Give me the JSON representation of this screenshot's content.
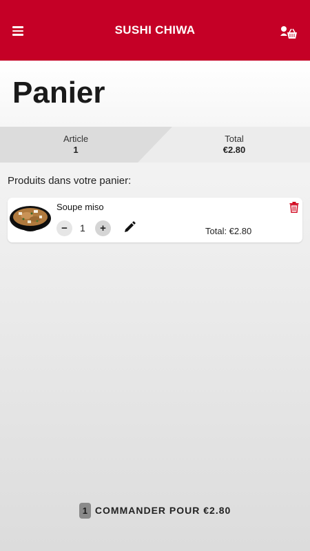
{
  "header": {
    "title": "SUSHI CHIWA",
    "menu_icon": "hamburger-menu-icon",
    "cart_icon": "basket-user-icon",
    "color": "#c50026"
  },
  "page": {
    "title": "Panier"
  },
  "summary": {
    "article_label": "Article",
    "article_value": "1",
    "total_label": "Total",
    "total_value": "€2.80"
  },
  "cart": {
    "section_label": "Produits dans votre panier:",
    "items": [
      {
        "name": "Soupe miso",
        "quantity": "1",
        "minus": "−",
        "plus": "+",
        "line_total": "Total: €2.80",
        "image_icon": "miso-soup-bowl"
      }
    ]
  },
  "checkout": {
    "count": "1",
    "label": "COMMANDER POUR €2.80"
  },
  "colors": {
    "accent": "#c50026",
    "delete": "#d0021b"
  }
}
